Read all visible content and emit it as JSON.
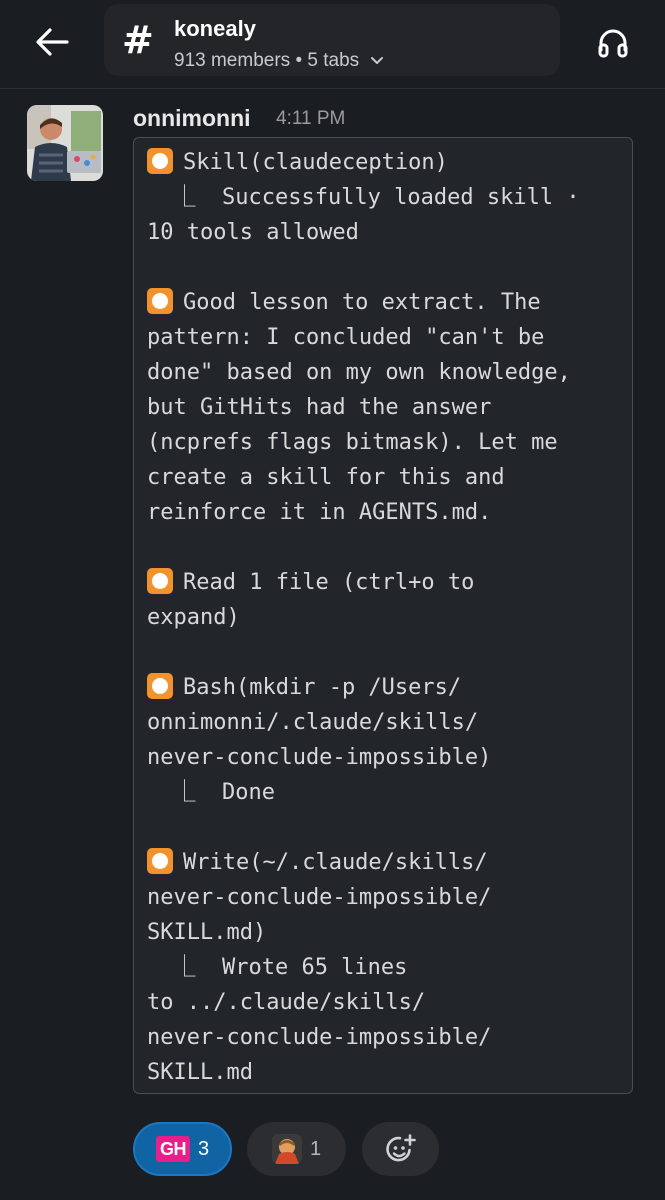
{
  "header": {
    "channel_hash": "#",
    "channel_name": "konealy",
    "members": "913 members",
    "separator": "•",
    "tabs": "5 tabs"
  },
  "message": {
    "username": "onnimonni",
    "timestamp": "4:11 PM",
    "lines": [
      {
        "bullet": true,
        "text": "Skill(claudeception)"
      },
      {
        "bullet": false,
        "text": "  ⎿  Successfully loaded skill ·"
      },
      {
        "bullet": false,
        "text": "10 tools allowed"
      },
      {
        "bullet": false,
        "text": ""
      },
      {
        "bullet": true,
        "text": "Good lesson to extract. The"
      },
      {
        "bullet": false,
        "text": "pattern: I concluded \"can't be"
      },
      {
        "bullet": false,
        "text": "done\" based on my own knowledge,"
      },
      {
        "bullet": false,
        "text": "but GitHits had the answer"
      },
      {
        "bullet": false,
        "text": "(ncprefs flags bitmask). Let me"
      },
      {
        "bullet": false,
        "text": "create a skill for this and"
      },
      {
        "bullet": false,
        "text": "reinforce it in AGENTS.md."
      },
      {
        "bullet": false,
        "text": ""
      },
      {
        "bullet": true,
        "text": "Read 1 file (ctrl+o to"
      },
      {
        "bullet": false,
        "text": "expand)"
      },
      {
        "bullet": false,
        "text": ""
      },
      {
        "bullet": true,
        "text": "Bash(mkdir -p /Users/"
      },
      {
        "bullet": false,
        "text": "onnimonni/.claude/skills/"
      },
      {
        "bullet": false,
        "text": "never-conclude-impossible)"
      },
      {
        "bullet": false,
        "text": "  ⎿  Done"
      },
      {
        "bullet": false,
        "text": ""
      },
      {
        "bullet": true,
        "text": "Write(~/.claude/skills/"
      },
      {
        "bullet": false,
        "text": "never-conclude-impossible/"
      },
      {
        "bullet": false,
        "text": "SKILL.md)"
      },
      {
        "bullet": false,
        "text": "  ⎿  Wrote 65 lines"
      },
      {
        "bullet": false,
        "text": "to ../.claude/skills/"
      },
      {
        "bullet": false,
        "text": "never-conclude-impossible/"
      },
      {
        "bullet": false,
        "text": "SKILL.md"
      }
    ]
  },
  "reactions": [
    {
      "emoji_text": "GH",
      "count": "3",
      "active": true
    },
    {
      "emoji_icon": "user-photo-emoji",
      "count": "1",
      "active": false
    },
    {
      "emoji_icon": "add-reaction-icon",
      "count": "",
      "active": false
    }
  ],
  "colors": {
    "background": "#1a1d21",
    "bullet": "#f2922c",
    "active_reaction": "#1164a3",
    "gh_emoji": "#e61f8a"
  },
  "icons": {
    "back": "arrow-left-icon",
    "headphones": "headphones-icon",
    "chevron": "chevron-down-icon"
  }
}
